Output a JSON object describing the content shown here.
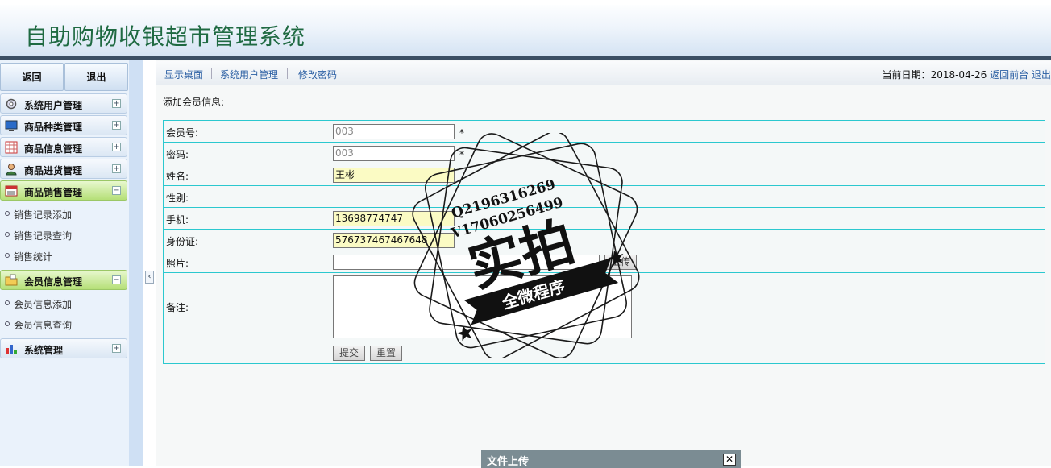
{
  "app": {
    "title": "自助购物收银超市管理系统"
  },
  "sidebar": {
    "back_label": "返回",
    "logout_label": "退出",
    "menus": [
      {
        "label": "系统用户管理",
        "icon": "gear-icon",
        "state": "+"
      },
      {
        "label": "商品种类管理",
        "icon": "monitor-icon",
        "state": "+"
      },
      {
        "label": "商品信息管理",
        "icon": "grid-icon",
        "state": "+"
      },
      {
        "label": "商品进货管理",
        "icon": "user-icon",
        "state": "+"
      },
      {
        "label": "商品销售管理",
        "icon": "register-icon",
        "state": "−",
        "items": [
          "销售记录添加",
          "销售记录查询",
          "销售统计"
        ]
      },
      {
        "label": "会员信息管理",
        "icon": "folder-icon",
        "state": "−",
        "items": [
          "会员信息添加",
          "会员信息查询"
        ]
      },
      {
        "label": "系统管理",
        "icon": "chart-icon",
        "state": "+"
      }
    ],
    "collapse_glyph": "‹"
  },
  "toolbar": {
    "links": [
      "显示桌面",
      "系统用户管理",
      "修改密码"
    ],
    "date_label": "当前日期：",
    "date": "2018-04-26",
    "front_link": "返回前台",
    "logout_link": "退出"
  },
  "form": {
    "caption": "添加会员信息:",
    "rows": [
      {
        "label": "会员号:",
        "value": "003",
        "required": "*"
      },
      {
        "label": "密码:",
        "value": "003",
        "required": "*"
      },
      {
        "label": "姓名:",
        "value": "王彬"
      },
      {
        "label": "性别:"
      },
      {
        "label": "手机:",
        "value": "13698774747"
      },
      {
        "label": "身份证:",
        "value": "576737467467648"
      },
      {
        "label": "照片:",
        "upload_label": "上传"
      },
      {
        "label": "备注:"
      }
    ],
    "submit_label": "提交",
    "reset_label": "重置"
  },
  "watermark": {
    "line1": "Q2196316269",
    "line2": "V17060256499",
    "main": "实拍",
    "ribbon": "全微程序"
  },
  "upload_dialog": {
    "title": "文件上传",
    "close": "✕"
  }
}
